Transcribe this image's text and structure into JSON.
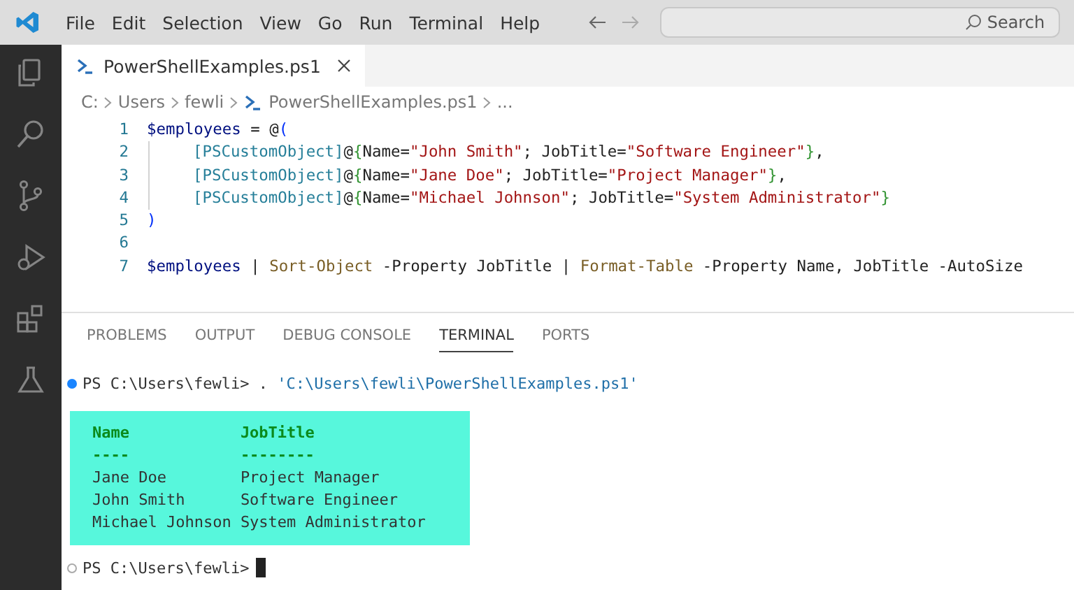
{
  "menu_bar": {
    "items": [
      "File",
      "Edit",
      "Selection",
      "View",
      "Go",
      "Run",
      "Terminal",
      "Help"
    ],
    "search": {
      "placeholder": "Search"
    }
  },
  "activity_bar": {
    "items": [
      {
        "kind": "explorer",
        "selected": false
      },
      {
        "kind": "search",
        "selected": false
      },
      {
        "kind": "source-control",
        "selected": false
      },
      {
        "kind": "run-debug",
        "selected": false
      },
      {
        "kind": "extensions",
        "selected": false
      },
      {
        "kind": "testing",
        "selected": false
      }
    ]
  },
  "editor_tabs": [
    {
      "label": "PowerShellExamples.ps1",
      "selected": true
    }
  ],
  "breadcrumb": [
    "C:",
    "Users",
    "fewli",
    "PowerShellExamples.ps1",
    "..."
  ],
  "code_lines": [
    {
      "number": "1",
      "indented": false,
      "tokens": [
        {
          "kind": "variable",
          "text": "$employees"
        },
        {
          "kind": "plain",
          "text": " = @"
        },
        {
          "kind": "bracket",
          "text": "("
        }
      ]
    },
    {
      "number": "2",
      "indented": true,
      "tokens": [
        {
          "kind": "type",
          "text": "[PSCustomObject]"
        },
        {
          "kind": "plain",
          "text": "@"
        },
        {
          "kind": "brace",
          "text": "{"
        },
        {
          "kind": "plain",
          "text": "Name="
        },
        {
          "kind": "string",
          "text": "\"John Smith\""
        },
        {
          "kind": "plain",
          "text": "; JobTitle="
        },
        {
          "kind": "string",
          "text": "\"Software Engineer\""
        },
        {
          "kind": "brace",
          "text": "}"
        },
        {
          "kind": "plain",
          "text": ","
        }
      ]
    },
    {
      "number": "3",
      "indented": true,
      "tokens": [
        {
          "kind": "type",
          "text": "[PSCustomObject]"
        },
        {
          "kind": "plain",
          "text": "@"
        },
        {
          "kind": "brace",
          "text": "{"
        },
        {
          "kind": "plain",
          "text": "Name="
        },
        {
          "kind": "string",
          "text": "\"Jane Doe\""
        },
        {
          "kind": "plain",
          "text": "; JobTitle="
        },
        {
          "kind": "string",
          "text": "\"Project Manager\""
        },
        {
          "kind": "brace",
          "text": "}"
        },
        {
          "kind": "plain",
          "text": ","
        }
      ]
    },
    {
      "number": "4",
      "indented": true,
      "tokens": [
        {
          "kind": "type",
          "text": "[PSCustomObject]"
        },
        {
          "kind": "plain",
          "text": "@"
        },
        {
          "kind": "brace",
          "text": "{"
        },
        {
          "kind": "plain",
          "text": "Name="
        },
        {
          "kind": "string",
          "text": "\"Michael Johnson\""
        },
        {
          "kind": "plain",
          "text": "; JobTitle="
        },
        {
          "kind": "string",
          "text": "\"System Administrator\""
        },
        {
          "kind": "brace",
          "text": "}"
        }
      ]
    },
    {
      "number": "5",
      "indented": false,
      "tokens": [
        {
          "kind": "bracket",
          "text": ")"
        }
      ]
    },
    {
      "number": "6",
      "indented": false
    },
    {
      "number": "7",
      "indented": false,
      "tokens": [
        {
          "kind": "variable",
          "text": "$employees"
        },
        {
          "kind": "plain",
          "text": " | "
        },
        {
          "kind": "command",
          "text": "Sort-Object"
        },
        {
          "kind": "plain",
          "text": " -Property JobTitle | "
        },
        {
          "kind": "command",
          "text": "Format-Table"
        },
        {
          "kind": "plain",
          "text": " -Property Name, JobTitle -AutoSize"
        }
      ]
    }
  ],
  "panel_tabs": [
    {
      "label": "PROBLEMS",
      "selected": false
    },
    {
      "label": "OUTPUT",
      "selected": false
    },
    {
      "label": "DEBUG CONSOLE",
      "selected": false
    },
    {
      "label": "TERMINAL",
      "selected": true
    },
    {
      "label": "PORTS",
      "selected": false
    }
  ],
  "terminal": {
    "command_line": {
      "finished": true,
      "prompt": "PS C:\\Users\\fewli>",
      "command": ". ",
      "argument": "'C:\\Users\\fewli\\PowerShellExamples.ps1'"
    },
    "output_table": {
      "columns": [
        "Name",
        "JobTitle"
      ],
      "underlines": [
        "----",
        "--------"
      ],
      "rows": [
        [
          "Jane Doe",
          "Project Manager"
        ],
        [
          "John Smith",
          "Software Engineer"
        ],
        [
          "Michael Johnson",
          "System Administrator"
        ]
      ]
    },
    "prompt_line": {
      "finished": false,
      "prompt": "PS C:\\Users\\fewli>"
    }
  }
}
